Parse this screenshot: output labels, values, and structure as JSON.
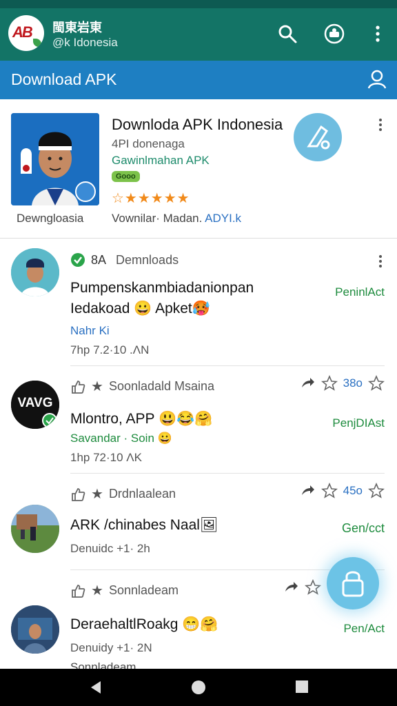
{
  "app": {
    "title": "閩東岩東",
    "subtitle": "@k Idonesia",
    "logo_text": "AB"
  },
  "subbar": {
    "label": "Download APK"
  },
  "hero": {
    "title": "Downloda APK Indonesia",
    "subtitle": "4PI donenaga",
    "link": "Gawinlmahan APK",
    "badge": "Gooo",
    "stars": "☆★★★★★",
    "caption": "Dewngloasia",
    "meta_prefix": "Vownilar· Madan.",
    "meta_link": "ADYI.k"
  },
  "items": [
    {
      "top_label": "8A",
      "top_text": "Demnloads",
      "title_line1": "Pumpenskanmbiadanionpan",
      "title_line2": "Iedakoad 😀 Apket🥵",
      "sub1": "Nahr Ki",
      "sub2": "7hp  7.2·10 .ΛN",
      "state": "PeninlAct"
    },
    {
      "top_text": "Soonladald Msaina",
      "count": "38o",
      "title": "Mlontro, APP 😃😂🤗",
      "sub1": "Savandar · Soin 😀",
      "sub2": "1hp  72·10 ΛK",
      "state": "PenjDIAst",
      "avatar_text": "VAVG"
    },
    {
      "top_text": "Drdnlaalean",
      "count": "45o",
      "title": "ARK /chinabes Naal🖼",
      "sub1": "Denuidc +1· 2h",
      "state": "Gen/cct"
    },
    {
      "top_text": "Sonnladeam",
      "title": "DeraehaltlRoakg 😁🤗",
      "sub1": "Denuidy +1· 2N",
      "state": "Pen/Act",
      "cut_text": "Sonnladeam"
    }
  ],
  "colors": {
    "appbar": "#137466",
    "subbar": "#1e7fc2",
    "accent_green": "#1d8b3d",
    "link_blue": "#2a70c2"
  }
}
